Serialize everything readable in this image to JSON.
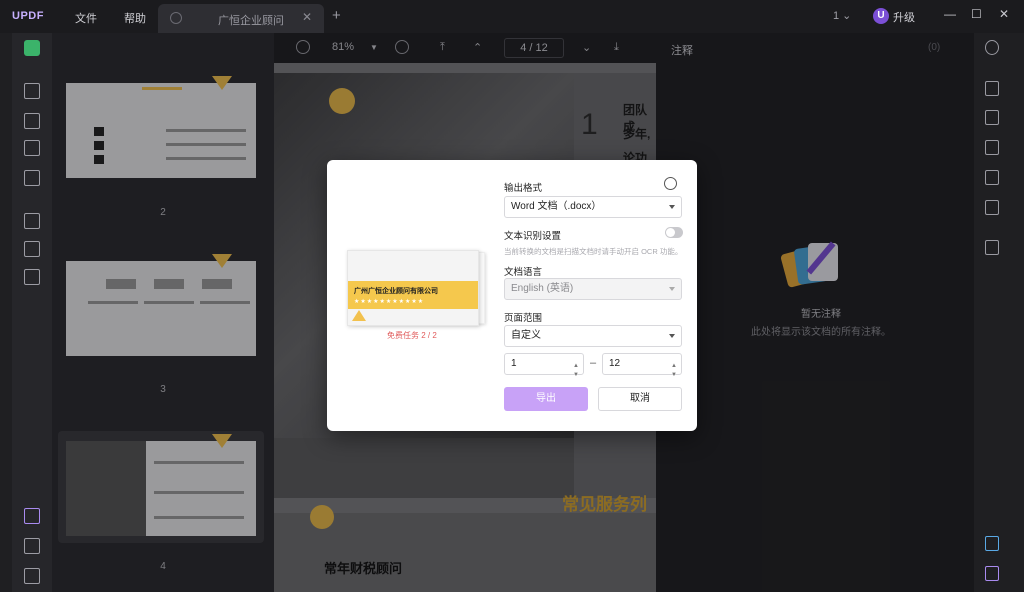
{
  "app": {
    "logo": "UPDF",
    "menu": [
      "文件",
      "帮助"
    ],
    "tab_title": "广恒企业顾问",
    "new_tab": "+",
    "page_count": "1",
    "upgrade_avatar": "U",
    "upgrade_label": "升级",
    "window_buttons": [
      "—",
      "☐",
      "✕"
    ]
  },
  "toolbar": {
    "zoom": "81%",
    "page_indicator": "4 / 12"
  },
  "thumbnails": {
    "labels": [
      "2",
      "3",
      "4"
    ]
  },
  "document": {
    "big_number": "1",
    "lines": [
      "团队成",
      "多年,",
      "论功底"
    ],
    "section_heading": "常见服务列",
    "sub_heading": "常年财税顾问"
  },
  "annotations": {
    "title": "注释",
    "count": "(0)",
    "empty_title": "暂无注释",
    "empty_desc": "此处将显示该文档的所有注释。"
  },
  "dialog": {
    "preview_company": "广州广恒企业顾问有限公司",
    "preview_dots": "★★★★★★★★★★★",
    "preview_note": "免费任务    2 / 2",
    "format_label": "输出格式",
    "format_value": "Word 文档（.docx）",
    "ocr_label": "文本识别设置",
    "ocr_hint": "当前转换的文档是扫描文档时请手动开启 OCR 功能。",
    "language_label": "文档语言",
    "language_value": "English (英语)",
    "range_label": "页面范围",
    "range_value": "自定义",
    "range_from": "1",
    "range_to": "12",
    "range_sep": "–",
    "export_button": "导出",
    "cancel_button": "取消"
  },
  "colors": {
    "accent": "#c8a2f7",
    "brand": "#7b4fd6",
    "highlight": "#f5c84d"
  }
}
